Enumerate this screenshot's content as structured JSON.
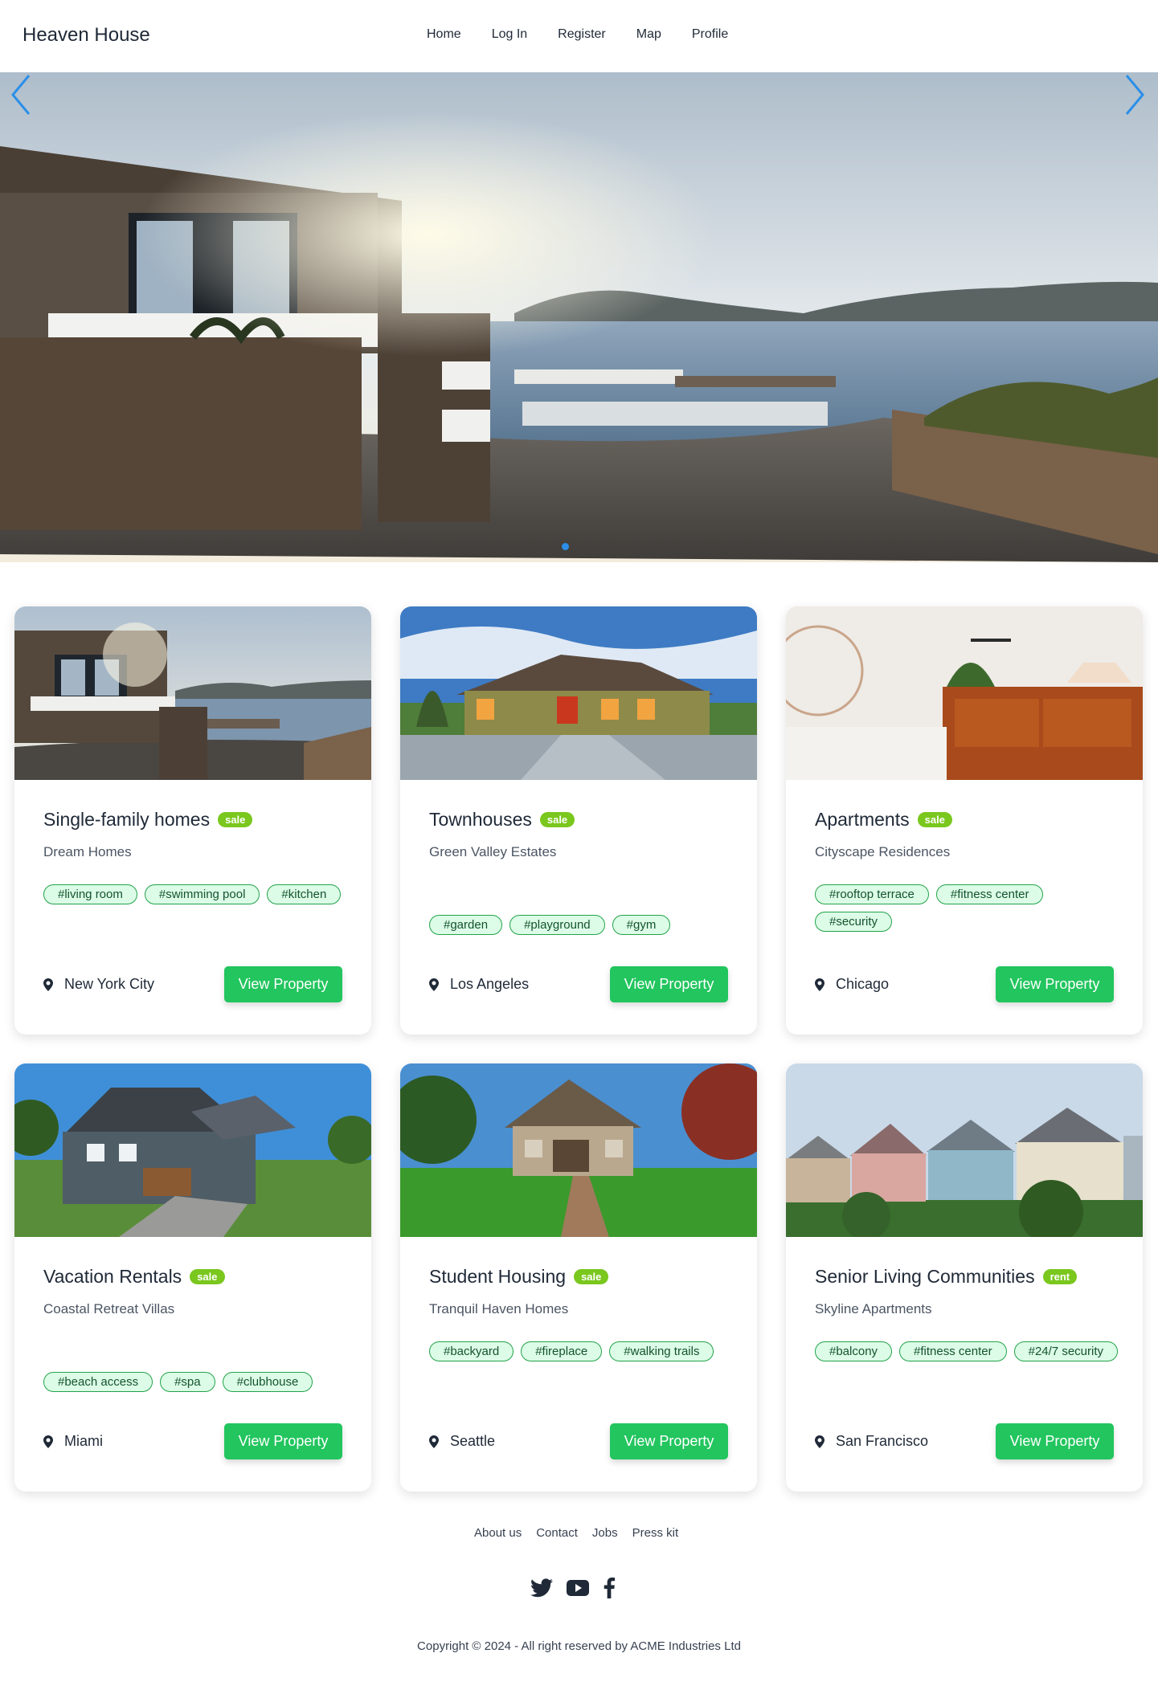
{
  "nav": {
    "brand": "Heaven House",
    "links": [
      "Home",
      "Log In",
      "Register",
      "Map",
      "Profile"
    ]
  },
  "hero": {
    "prev_icon": "chevron-left-icon",
    "next_icon": "chevron-right-icon",
    "slides_indicator_count": 1
  },
  "cards": [
    {
      "title": "Single-family homes",
      "badge": "sale",
      "subtitle": "Dream Homes",
      "tags": [
        "#living room",
        "#swimming pool",
        "#kitchen"
      ],
      "location": "New York City",
      "button": "View Property"
    },
    {
      "title": "Townhouses",
      "badge": "sale",
      "subtitle": "Green Valley Estates",
      "tags": [
        "#garden",
        "#playground",
        "#gym"
      ],
      "location": "Los Angeles",
      "button": "View Property"
    },
    {
      "title": "Apartments",
      "badge": "sale",
      "subtitle": "Cityscape Residences",
      "tags": [
        "#rooftop terrace",
        "#fitness center",
        "#security"
      ],
      "location": "Chicago",
      "button": "View Property"
    },
    {
      "title": "Vacation Rentals",
      "badge": "sale",
      "subtitle": "Coastal Retreat Villas",
      "tags": [
        "#beach access",
        "#spa",
        "#clubhouse"
      ],
      "location": "Miami",
      "button": "View Property"
    },
    {
      "title": "Student Housing",
      "badge": "sale",
      "subtitle": "Tranquil Haven Homes",
      "tags": [
        "#backyard",
        "#fireplace",
        "#walking trails"
      ],
      "location": "Seattle",
      "button": "View Property"
    },
    {
      "title": "Senior Living Communities",
      "badge": "rent",
      "subtitle": "Skyline Apartments",
      "tags": [
        "#balcony",
        "#fitness center",
        "#24/7 security"
      ],
      "location": "San Francisco",
      "button": "View Property"
    }
  ],
  "footer": {
    "links": [
      "About us",
      "Contact",
      "Jobs",
      "Press kit"
    ],
    "social_icons": [
      "twitter-icon",
      "youtube-icon",
      "facebook-icon"
    ],
    "copyright": "Copyright © 2024 - All right reserved by ACME Industries Ltd"
  },
  "colors": {
    "accent_green": "#22c55e",
    "badge_green": "#7ac71e",
    "tag_bg": "#dcfce7",
    "carousel_blue": "#2b8fe8"
  }
}
